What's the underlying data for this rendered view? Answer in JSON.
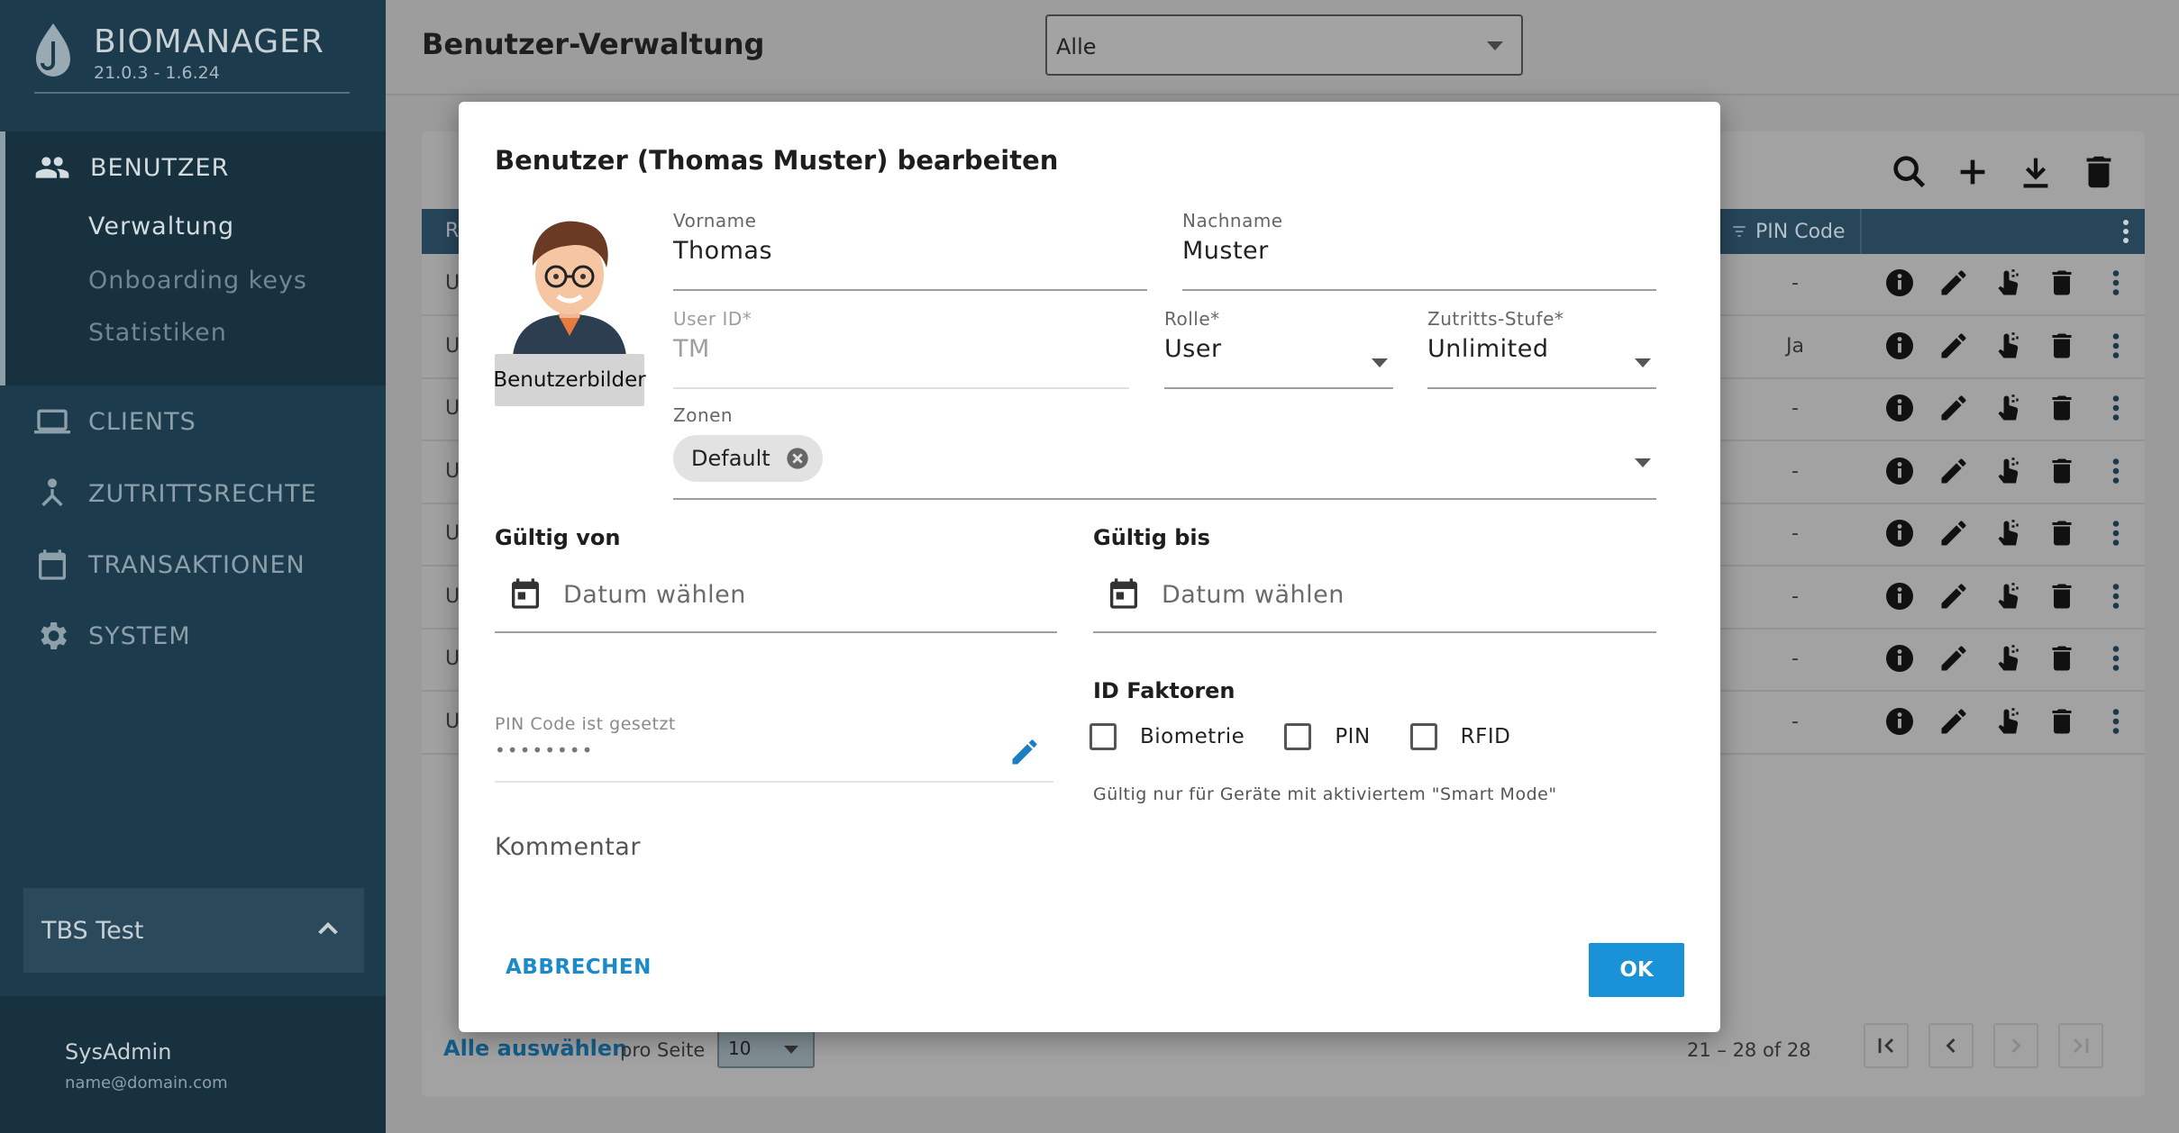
{
  "app": {
    "name": "BIOMANAGER",
    "version": "21.0.3 - 1.6.24"
  },
  "sidebar": {
    "section": {
      "label": "BENUTZER",
      "icon": "people-icon"
    },
    "sub_items": [
      {
        "label": "Verwaltung",
        "active": true
      },
      {
        "label": "Onboarding keys"
      },
      {
        "label": "Statistiken"
      }
    ],
    "items": [
      {
        "label": "CLIENTS",
        "icon": "laptop-icon"
      },
      {
        "label": "ZUTRITTSRECHTE",
        "icon": "access-rights-icon"
      },
      {
        "label": "TRANSAKTIONEN",
        "icon": "calendar-icon"
      },
      {
        "label": "SYSTEM",
        "icon": "gear-icon"
      }
    ],
    "tenant": "TBS Test",
    "user": {
      "name": "SysAdmin",
      "email": "name@domain.com"
    }
  },
  "header": {
    "title": "Benutzer-Verwaltung",
    "filter_value": "Alle"
  },
  "table": {
    "header_first_fragment": "R",
    "pin_column": "PIN Code",
    "rows": [
      {
        "lead": "U",
        "pin": "-"
      },
      {
        "lead": "U",
        "pin": "Ja"
      },
      {
        "lead": "U",
        "pin": "-"
      },
      {
        "lead": "U",
        "pin": "-"
      },
      {
        "lead": "U",
        "pin": "-"
      },
      {
        "lead": "U",
        "pin": "-"
      },
      {
        "lead": "U",
        "pin": "-"
      },
      {
        "lead": "U",
        "pin": "-"
      }
    ]
  },
  "footer": {
    "select_all": "Alle auswählen",
    "per_page_label": "pro Seite",
    "per_page_value": "10",
    "range": "21 – 28 of 28"
  },
  "modal": {
    "title": "Benutzer (Thomas Muster) bearbeiten",
    "avatar_button": "Benutzerbilder",
    "first_name": {
      "label": "Vorname",
      "value": "Thomas"
    },
    "last_name": {
      "label": "Nachname",
      "value": "Muster"
    },
    "user_id": {
      "label": "User ID*",
      "value": "TM"
    },
    "role": {
      "label": "Rolle*",
      "value": "User"
    },
    "access_level": {
      "label": "Zutritts-Stufe*",
      "value": "Unlimited"
    },
    "zones": {
      "label": "Zonen",
      "chips": [
        "Default"
      ]
    },
    "valid_from": {
      "label": "Gültig von",
      "placeholder": "Datum wählen"
    },
    "valid_to": {
      "label": "Gültig bis",
      "placeholder": "Datum wählen"
    },
    "pin": {
      "label": "PIN Code ist gesetzt",
      "masked": "••••••••"
    },
    "id_factors": {
      "label": "ID Faktoren",
      "options": [
        "Biometrie",
        "PIN",
        "RFID"
      ],
      "hint": "Gültig nur für Geräte mit aktiviertem \"Smart Mode\""
    },
    "comment_placeholder": "Kommentar",
    "cancel_label": "ABBRECHEN",
    "ok_label": "OK",
    "accent_color": "#1a92d8"
  }
}
